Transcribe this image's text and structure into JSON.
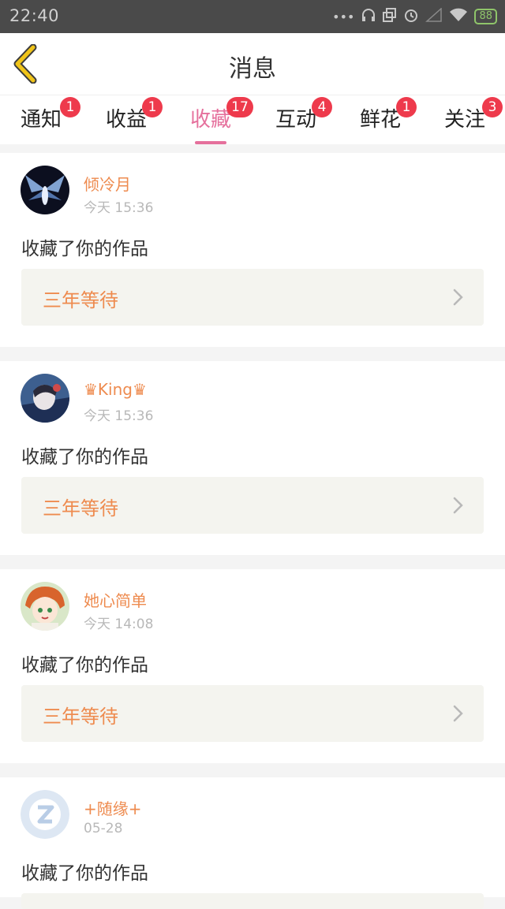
{
  "status_bar": {
    "time": "22:40",
    "battery": "88"
  },
  "header": {
    "title": "消息"
  },
  "tabs": [
    {
      "label": "通知",
      "badge": "1"
    },
    {
      "label": "收益",
      "badge": "1"
    },
    {
      "label": "收藏",
      "badge": "17",
      "active": true
    },
    {
      "label": "互动",
      "badge": "4"
    },
    {
      "label": "鲜花",
      "badge": "1"
    },
    {
      "label": "关注",
      "badge": "3"
    }
  ],
  "messages": [
    {
      "user": "倾冷月",
      "time": "今天 15:36",
      "text": "收藏了你的作品",
      "work_title": "三年等待"
    },
    {
      "user": "♛King♛",
      "time": "今天 15:36",
      "text": "收藏了你的作品",
      "work_title": "三年等待"
    },
    {
      "user": "她心简单",
      "time": "今天 14:08",
      "text": "收藏了你的作品",
      "work_title": "三年等待"
    },
    {
      "user": "+随缘+",
      "time": "05-28",
      "text": "收藏了你的作品",
      "work_title": ""
    }
  ],
  "colors": {
    "accent_pink": "#e5709c",
    "name_orange": "#ee8b4f",
    "badge_red": "#ee3a4c",
    "back_yellow": "#f0c419"
  },
  "icons": [
    "back-arrow-icon",
    "chevron-right-icon",
    "signal-icon",
    "wifi-icon",
    "alarm-icon",
    "headphone-icon"
  ]
}
